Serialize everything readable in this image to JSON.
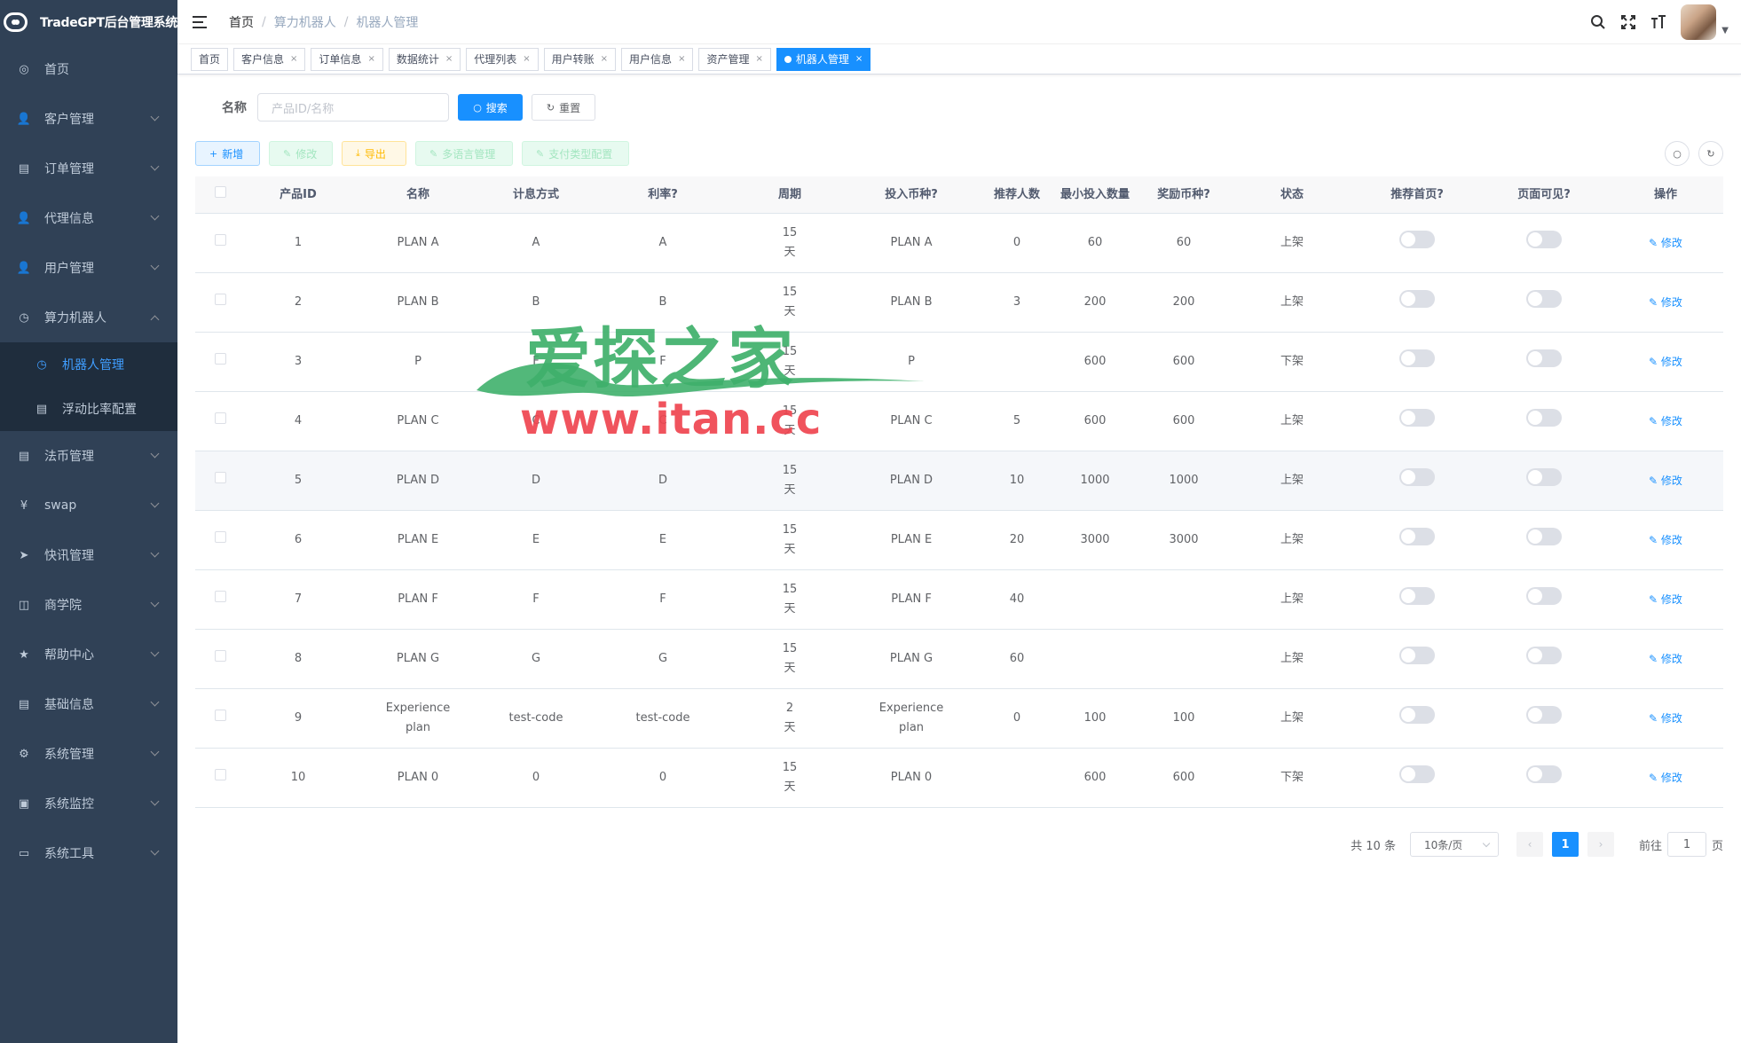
{
  "app": {
    "title": "TradeGPT后台管理系统"
  },
  "sidebar": {
    "items": [
      {
        "label": "首页",
        "icon": "dashboard-icon",
        "glyph": "◎"
      },
      {
        "label": "客户管理",
        "icon": "user-icon",
        "glyph": "👤"
      },
      {
        "label": "订单管理",
        "icon": "document-icon",
        "glyph": "▤"
      },
      {
        "label": "代理信息",
        "icon": "user-icon",
        "glyph": "👤"
      },
      {
        "label": "用户管理",
        "icon": "user-icon",
        "glyph": "👤"
      },
      {
        "label": "算力机器人",
        "icon": "clock-icon",
        "glyph": "◷"
      }
    ],
    "sub_items": [
      {
        "label": "机器人管理",
        "icon": "clock-icon",
        "glyph": "◷"
      },
      {
        "label": "浮动比率配置",
        "icon": "document-icon",
        "glyph": "▤"
      }
    ],
    "items2": [
      {
        "label": "法币管理",
        "icon": "document-icon",
        "glyph": "▤"
      },
      {
        "label": "swap",
        "icon": "yen-icon",
        "glyph": "¥"
      },
      {
        "label": "快讯管理",
        "icon": "send-icon",
        "glyph": "➤"
      },
      {
        "label": "商学院",
        "icon": "book-icon",
        "glyph": "◫"
      },
      {
        "label": "帮助中心",
        "icon": "star-icon",
        "glyph": "★"
      },
      {
        "label": "基础信息",
        "icon": "document-icon",
        "glyph": "▤"
      },
      {
        "label": "系统管理",
        "icon": "gear-icon",
        "glyph": "⚙"
      },
      {
        "label": "系统监控",
        "icon": "monitor-icon",
        "glyph": "▣"
      },
      {
        "label": "系统工具",
        "icon": "toolbox-icon",
        "glyph": "▭"
      }
    ]
  },
  "breadcrumb": [
    "首页",
    "算力机器人",
    "机器人管理"
  ],
  "tags": [
    "首页",
    "客户信息",
    "订单信息",
    "数据统计",
    "代理列表",
    "用户转账",
    "用户信息",
    "资产管理",
    "机器人管理"
  ],
  "search": {
    "label": "名称",
    "placeholder": "产品ID/名称",
    "search_btn": "搜索",
    "reset_btn": "重置"
  },
  "toolbar": {
    "add": "新增",
    "edit": "修改",
    "export": "导出",
    "lang": "多语言管理",
    "pay": "支付类型配置"
  },
  "table": {
    "headers": [
      "产品ID",
      "名称",
      "计息方式",
      "利率?",
      "周期",
      "投入币种?",
      "推荐人数",
      "最小投入数量",
      "奖励币种?",
      "状态",
      "推荐首页?",
      "页面可见?",
      "操作"
    ],
    "op_label": "修改",
    "rows": [
      [
        "1",
        "PLAN A",
        "A",
        "A",
        "15天",
        "PLAN A",
        "0",
        "60",
        "60",
        "上架"
      ],
      [
        "2",
        "PLAN B",
        "B",
        "B",
        "15天",
        "PLAN B",
        "3",
        "200",
        "200",
        "上架"
      ],
      [
        "3",
        "P",
        "F",
        "F",
        "15天",
        "P",
        "",
        "600",
        "600",
        "下架"
      ],
      [
        "4",
        "PLAN C",
        "C",
        "C",
        "15天",
        "PLAN C",
        "5",
        "600",
        "600",
        "上架"
      ],
      [
        "5",
        "PLAN D",
        "D",
        "D",
        "15天",
        "PLAN D",
        "10",
        "1000",
        "1000",
        "上架"
      ],
      [
        "6",
        "PLAN E",
        "E",
        "E",
        "15天",
        "PLAN E",
        "20",
        "3000",
        "3000",
        "上架"
      ],
      [
        "7",
        "PLAN F",
        "F",
        "F",
        "15天",
        "PLAN F",
        "40",
        "",
        "",
        "上架"
      ],
      [
        "8",
        "PLAN G",
        "G",
        "G",
        "15天",
        "PLAN G",
        "60",
        "",
        "",
        "上架"
      ],
      [
        "9",
        "Experience plan",
        "test-code",
        "test-code",
        "2天",
        "Experience plan",
        "0",
        "100",
        "100",
        "上架"
      ],
      [
        "10",
        "PLAN 0",
        "0",
        "0",
        "15天",
        "PLAN 0",
        "",
        "600",
        "600",
        "下架"
      ]
    ]
  },
  "pagination": {
    "total": "共 10 条",
    "page_size": "10条/页",
    "current": "1",
    "goto_prefix": "前往",
    "goto_value": "1",
    "goto_suffix": "页"
  },
  "watermark": {
    "cn": "爱探之家",
    "url": "www.itan.cc"
  },
  "colors": {
    "sidebar_bg": "#304156",
    "primary": "#1890ff",
    "watermark_green": "#3fb06b",
    "watermark_red": "#ef4550"
  }
}
